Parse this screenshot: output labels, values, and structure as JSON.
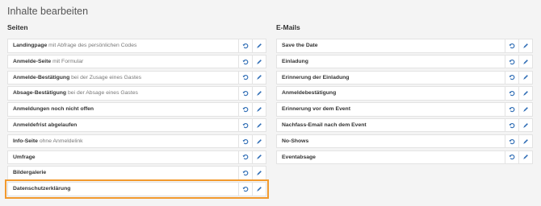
{
  "page_title": "Inhalte bearbeiten",
  "colors": {
    "icon": "#2f6db5",
    "highlight": "#f29a2e"
  },
  "icons": {
    "reset": "undo-icon",
    "edit": "pencil-icon"
  },
  "seiten": {
    "title": "Seiten",
    "items": [
      {
        "label": "Landingpage",
        "sub": " mit Abfrage des persönlichen Codes"
      },
      {
        "label": "Anmelde-Seite",
        "sub": " mit Formular"
      },
      {
        "label": "Anmelde-Bestätigung",
        "sub": " bei der Zusage eines Gastes"
      },
      {
        "label": "Absage-Bestätigung",
        "sub": " bei der Absage eines Gastes"
      },
      {
        "label": "Anmeldungen noch nicht offen",
        "sub": ""
      },
      {
        "label": "Anmeldefrist abgelaufen",
        "sub": ""
      },
      {
        "label": "Info-Seite",
        "sub": " ohne Anmeldelink"
      },
      {
        "label": "Umfrage",
        "sub": ""
      },
      {
        "label": "Bildergalerie",
        "sub": ""
      },
      {
        "label": "Datenschutzerklärung",
        "sub": ""
      }
    ]
  },
  "emails": {
    "title": "E-Mails",
    "items": [
      {
        "label": "Save the Date"
      },
      {
        "label": "Einladung"
      },
      {
        "label": "Erinnerung der Einladung"
      },
      {
        "label": "Anmeldebestätigung"
      },
      {
        "label": "Erinnerung vor dem Event"
      },
      {
        "label": "Nachfass-Email nach dem Event"
      },
      {
        "label": "No-Shows"
      },
      {
        "label": "Eventabsage"
      }
    ]
  }
}
